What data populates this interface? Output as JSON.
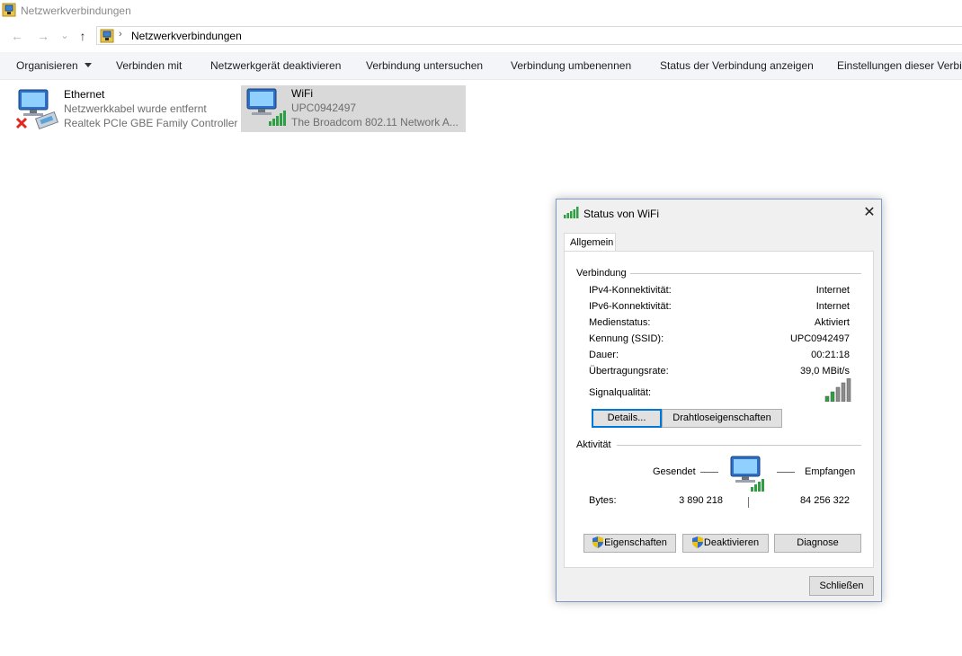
{
  "window": {
    "title": "Netzwerkverbindungen"
  },
  "address": {
    "breadcrumb": "Netzwerkverbindungen",
    "separator": "›"
  },
  "nav": {
    "back": "←",
    "forward": "→",
    "recent": "⌄",
    "up": "↑"
  },
  "toolbar": {
    "organize": "Organisieren",
    "connect": "Verbinden mit",
    "disable": "Netzwerkgerät deaktivieren",
    "diagnose": "Verbindung untersuchen",
    "rename": "Verbindung umbenennen",
    "status": "Status der Verbindung anzeigen",
    "settings": "Einstellungen dieser Verbin"
  },
  "connections": [
    {
      "name": "Ethernet",
      "status": "Netzwerkkabel wurde entfernt",
      "device": "Realtek PCIe GBE Family Controller"
    },
    {
      "name": "WiFi",
      "status": "UPC0942497",
      "device": "The Broadcom 802.11 Network A..."
    }
  ],
  "dialog": {
    "title": "Status von WiFi",
    "close": "✕",
    "tab": "Allgemein",
    "connection_group": "Verbindung",
    "rows": [
      {
        "label": "IPv4-Konnektivität:",
        "value": "Internet"
      },
      {
        "label": "IPv6-Konnektivität:",
        "value": "Internet"
      },
      {
        "label": "Medienstatus:",
        "value": "Aktiviert"
      },
      {
        "label": "Kennung (SSID):",
        "value": "UPC0942497"
      },
      {
        "label": "Dauer:",
        "value": "00:21:18"
      },
      {
        "label": "Übertragungsrate:",
        "value": "39,0 MBit/s"
      }
    ],
    "signal_label": "Signalqualität:",
    "signal_bars": 5,
    "details_button": "Details...",
    "wireless_button": "Drahtloseigenschaften",
    "activity_group": "Aktivität",
    "sent_label": "Gesendet",
    "received_label": "Empfangen",
    "bytes_label": "Bytes:",
    "bytes_sent": "3 890 218",
    "bytes_received": "84 256 322",
    "properties_button": "Eigenschaften",
    "deactivate_button": "Deaktivieren",
    "diagnose_button": "Diagnose",
    "close_button": "Schließen"
  },
  "colors": {
    "accent": "#0078d7",
    "signal": "#2ea043",
    "selected": "#d9d9d9",
    "toolbar": "#f3f5f9"
  }
}
